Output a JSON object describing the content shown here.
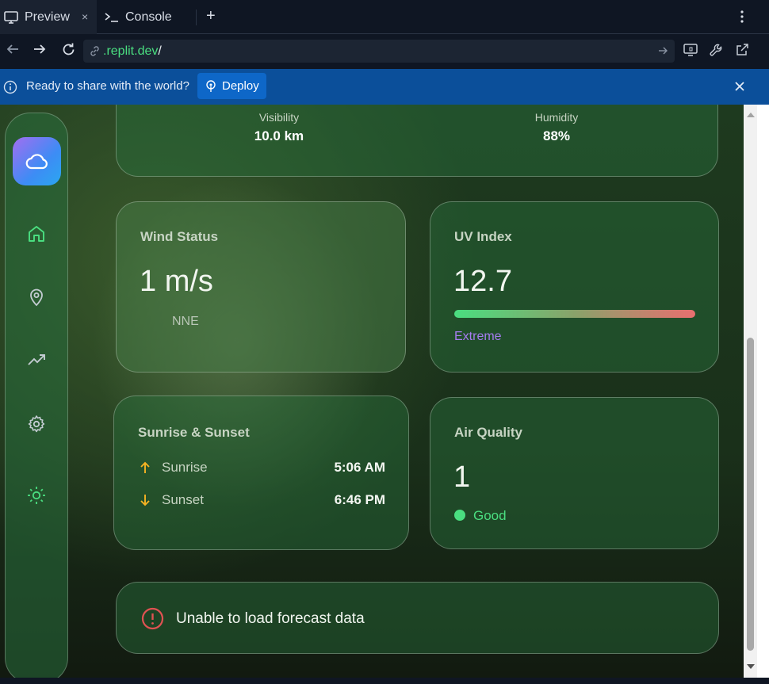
{
  "browser": {
    "tabs": [
      {
        "label": "Preview",
        "close": "×"
      },
      {
        "label": "Console"
      }
    ],
    "new_tab": "+",
    "url": {
      "domain": ".replit.dev",
      "path": "/"
    }
  },
  "banner": {
    "message": "Ready to share with the world?",
    "deploy_label": "Deploy"
  },
  "weather": {
    "details": {
      "visibility_label": "Visibility",
      "visibility_value": "10.0 km",
      "humidity_label": "Humidity",
      "humidity_value": "88%"
    },
    "wind": {
      "title": "Wind Status",
      "speed": "1 m/s",
      "direction": "NNE"
    },
    "uv": {
      "title": "UV Index",
      "value": "12.7",
      "level": "Extreme",
      "bar_fill": 1.0
    },
    "sun": {
      "title": "Sunrise & Sunset",
      "sunrise_label": "Sunrise",
      "sunrise_time": "5:06 AM",
      "sunset_label": "Sunset",
      "sunset_time": "6:46 PM"
    },
    "air": {
      "title": "Air Quality",
      "value": "1",
      "status": "Good"
    },
    "error": {
      "message": "Unable to load forecast data"
    }
  },
  "colors": {
    "accent_green": "#4ade80",
    "uv_level": "#a57cf0",
    "error_red": "#e05252",
    "sun_icon": "#f5b323",
    "banner_blue": "#0b4f9a"
  },
  "icons": {
    "sidebar": [
      "cloud-icon",
      "home-icon",
      "map-pin-icon",
      "trending-up-icon",
      "gear-icon",
      "sun-icon"
    ]
  }
}
